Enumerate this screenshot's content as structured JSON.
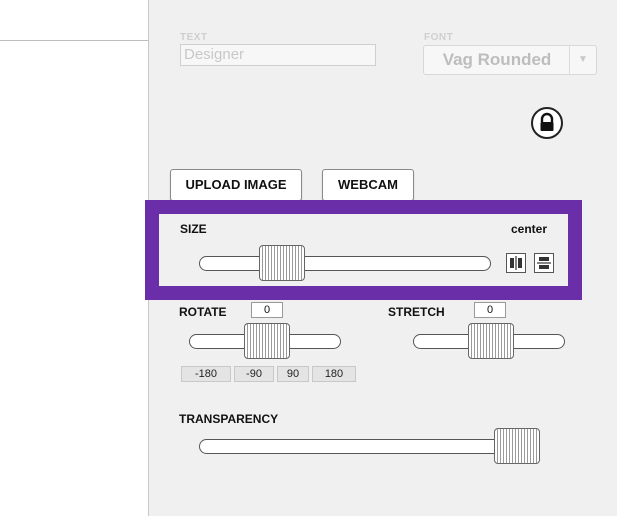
{
  "text_field": {
    "label": "TEXT",
    "placeholder": "Designer"
  },
  "font_field": {
    "label": "FONT",
    "value": "Vag Rounded"
  },
  "lock": {
    "icon": "padlock-icon"
  },
  "buttons": {
    "upload_label": "UPLOAD IMAGE",
    "webcam_label": "WEBCAM"
  },
  "size": {
    "label": "SIZE",
    "center_label": "center",
    "value": 0.14,
    "highlight_color": "#6a2fa8"
  },
  "rotate": {
    "label": "ROTATE",
    "value": "0",
    "presets": [
      "-180",
      "-90",
      "90",
      "180"
    ],
    "level": 0.5
  },
  "stretch": {
    "label": "STRETCH",
    "value": "0",
    "level": 0.5
  },
  "transparency": {
    "label": "TRANSPARENCY",
    "level": 1.0
  }
}
